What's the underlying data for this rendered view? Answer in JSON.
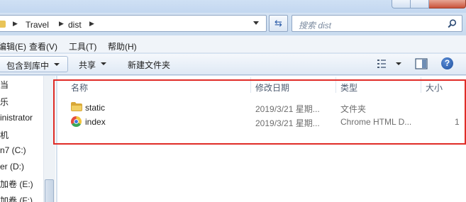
{
  "address": {
    "crumbs": [
      "Travel",
      "dist"
    ],
    "refresh_icon": "refresh-icon"
  },
  "search": {
    "placeholder": "搜索 dist"
  },
  "menu": {
    "items": [
      "编辑(E)",
      "查看(V)",
      "工具(T)",
      "帮助(H)"
    ]
  },
  "toolbar": {
    "include_library": "包含到库中",
    "share": "共享",
    "new_folder": "新建文件夹",
    "help_glyph": "?"
  },
  "nav": {
    "items": [
      "当",
      "乐",
      "inistrator",
      "机",
      "n7 (C:)",
      "er (D:)",
      "加卷 (E:)",
      "加卷 (F:)"
    ]
  },
  "columns": {
    "name": "名称",
    "date": "修改日期",
    "type": "类型",
    "size": "大小"
  },
  "files": [
    {
      "name": "static",
      "date": "2019/3/21 星期...",
      "type": "文件夹",
      "size": "",
      "icon": "folder-icon"
    },
    {
      "name": "index",
      "date": "2019/3/21 星期...",
      "type": "Chrome HTML D...",
      "size": "1",
      "icon": "chrome-icon"
    }
  ],
  "colors": {
    "highlight": "#e02c27",
    "folder": "#e9c458"
  }
}
